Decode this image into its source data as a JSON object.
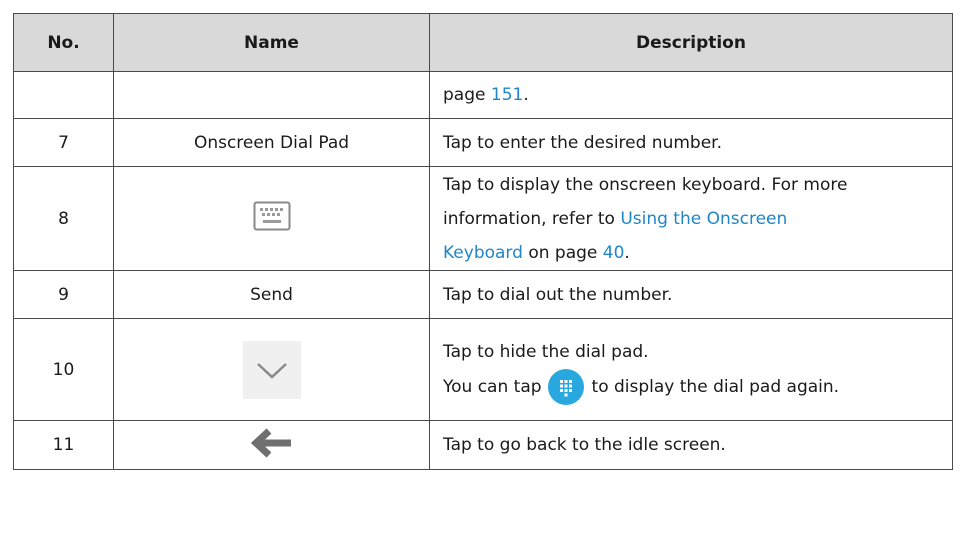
{
  "headers": {
    "no": "No.",
    "name": "Name",
    "description": "Description"
  },
  "rows": [
    {
      "no": "",
      "name": "",
      "desc_link": "151",
      "desc_tail": ".",
      "desc_pre": "page "
    },
    {
      "no": "7",
      "name": "Onscreen Dial Pad",
      "desc": "Tap to enter the desired number."
    },
    {
      "no": "8",
      "icon": "keyboard-icon",
      "desc_line1": "Tap to display the onscreen keyboard. For more",
      "desc_pre": "information, refer to ",
      "desc_link1": "Using the Onscreen",
      "desc_link1b": "Keyboard",
      "desc_mid": " on page ",
      "desc_link2": "40",
      "desc_tail": "."
    },
    {
      "no": "9",
      "name": "Send",
      "desc": "Tap to dial out the number."
    },
    {
      "no": "10",
      "icon": "chevron-down-icon",
      "desc_line1": "Tap to hide the dial pad.",
      "desc_pre": "You can tap",
      "inline_icon": "dialpad-icon",
      "desc_post": "to display the dial pad again."
    },
    {
      "no": "11",
      "icon": "arrow-left-icon",
      "desc": "Tap to go back to the idle screen."
    }
  ],
  "colors": {
    "header_bg": "#d9d9d9",
    "border": "#4a4a4a",
    "link": "#1f86c8",
    "dialpad_blue": "#29a8e0"
  }
}
